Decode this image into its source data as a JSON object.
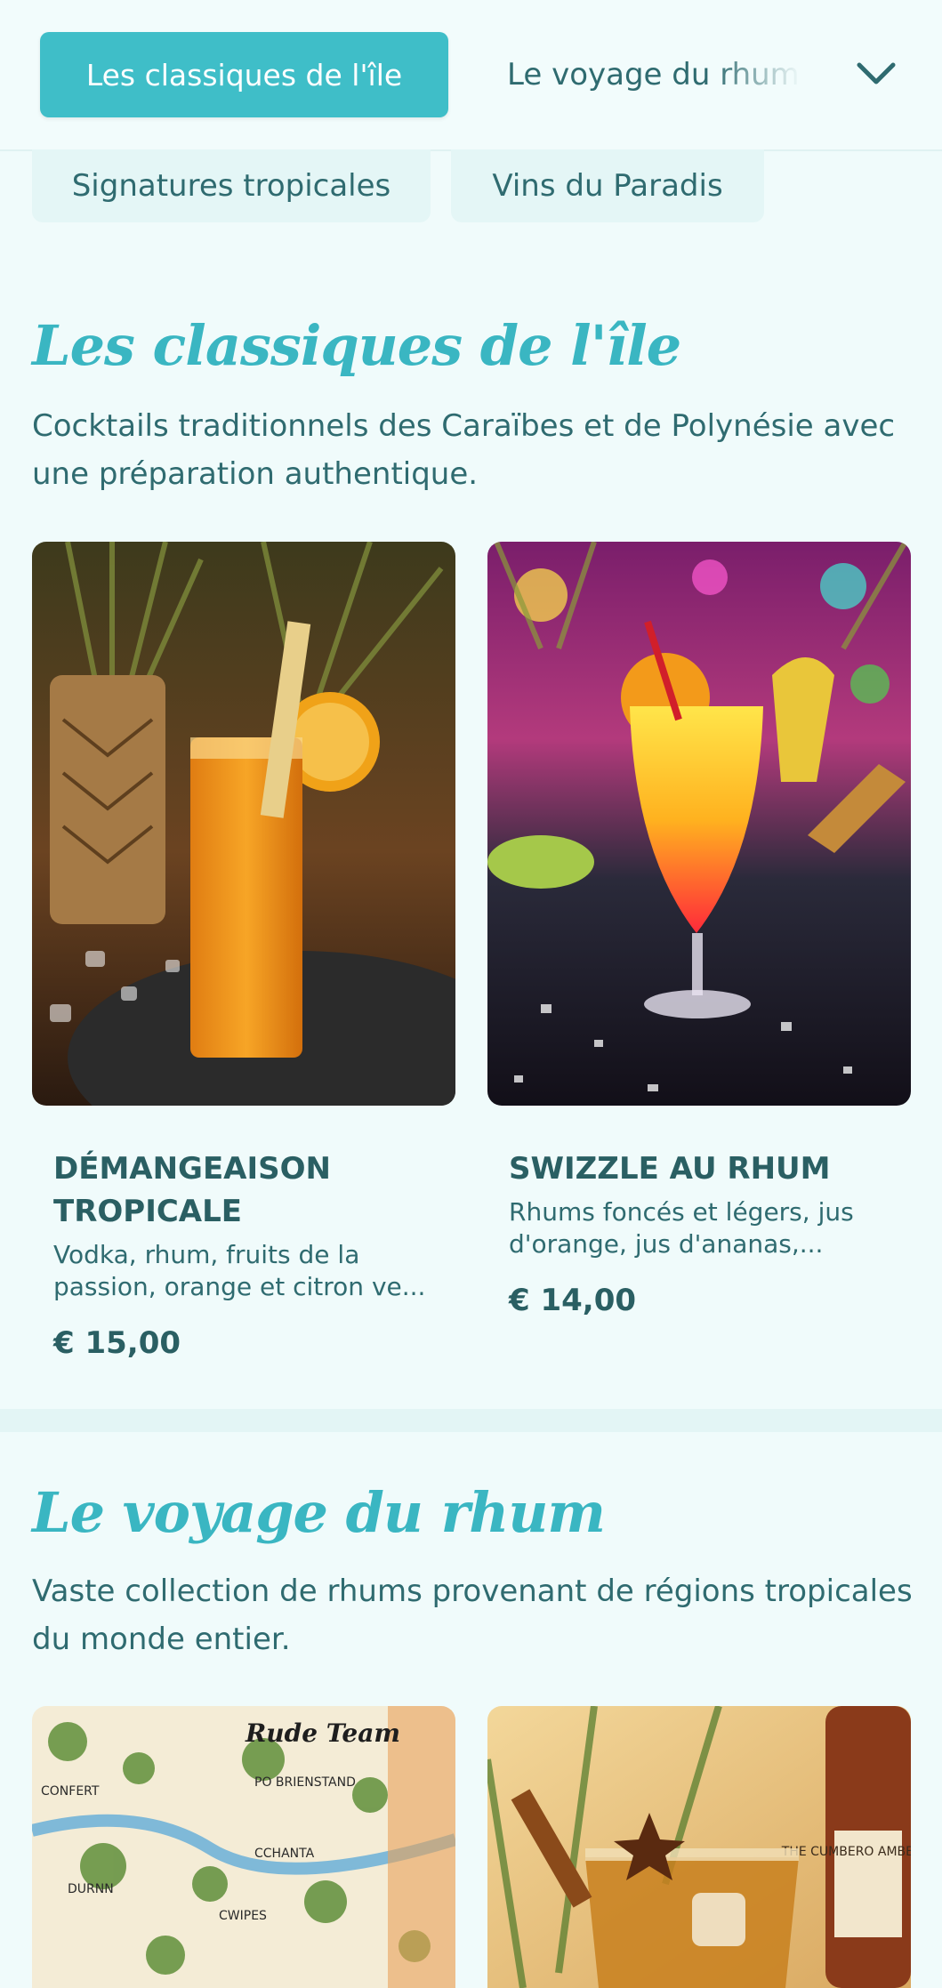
{
  "nav": {
    "active_tab": "Les classiques de l'île",
    "tab2": "Le voyage du rhum",
    "pill1": "Signatures tropicales",
    "pill2": "Vins du Paradis"
  },
  "sections": [
    {
      "title": "Les classiques de l'île",
      "description": "Cocktails traditionnels des Caraïbes et de Polynésie avec une préparation authentique.",
      "items": [
        {
          "name": "DÉMANGEAISON TROPICALE",
          "description": "Vodka, rhum, fruits de la passion, orange et citron ve...",
          "price": "€ 15,00"
        },
        {
          "name": "SWIZZLE AU RHUM",
          "description": "Rhums foncés et légers, jus d'orange, jus d'ananas,...",
          "price": "€ 14,00"
        }
      ]
    },
    {
      "title": "Le voyage du rhum",
      "description": "Vaste collection de rhums provenant de régions tropicales du monde entier.",
      "items": [
        {
          "image_brand_text": "Rude Team"
        },
        {
          "image_brand_text": "THE CUMBERO AMBER RUM"
        }
      ]
    }
  ],
  "colors": {
    "accent": "#3fbec8",
    "title": "#3ab6c2",
    "text": "#2a5f63",
    "background": "#f0fbfb"
  },
  "icons": {
    "dropdown": "chevron-down-icon"
  }
}
